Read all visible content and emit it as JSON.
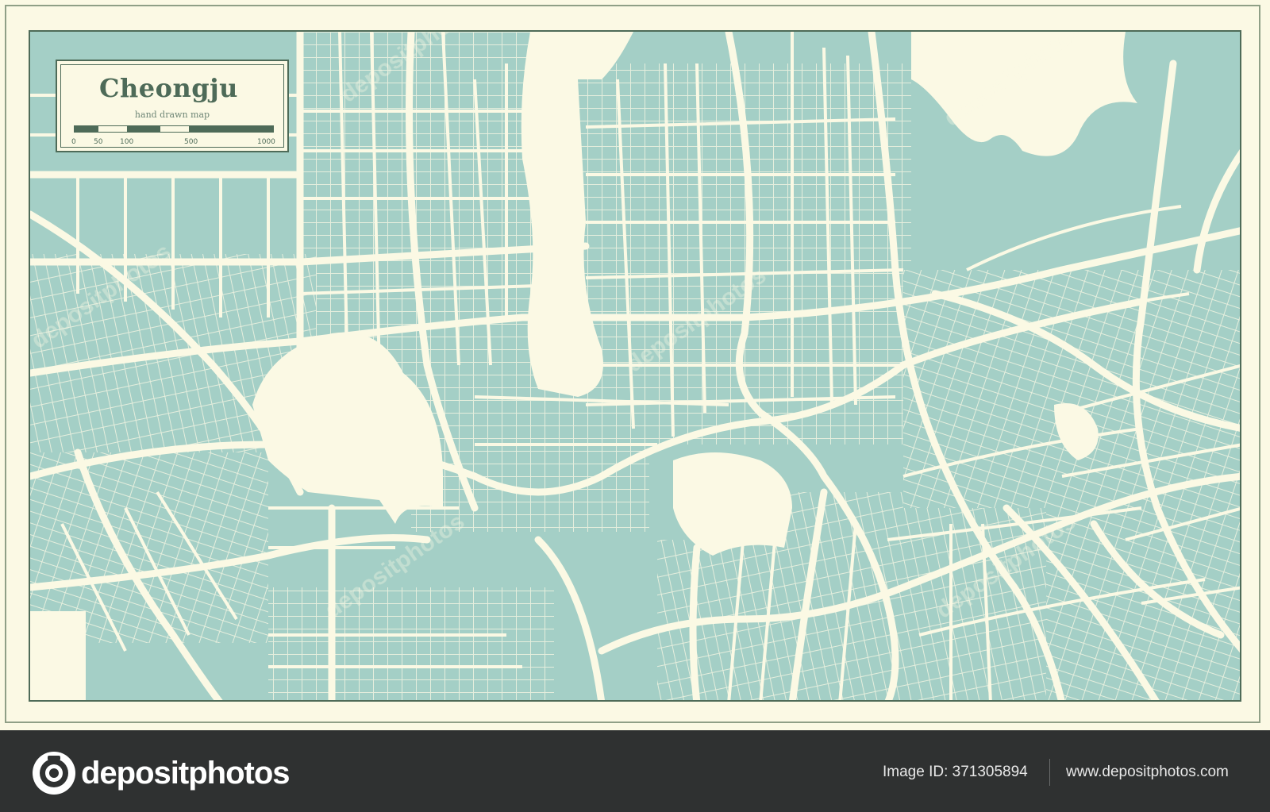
{
  "map": {
    "title": "Cheongju",
    "subtitle": "hand drawn map",
    "scale_labels": [
      "0",
      "50",
      "100",
      "500",
      "1000"
    ],
    "colors": {
      "background": "#fbf9e4",
      "water_block": "#a4cfc6",
      "road": "#fbf9e4",
      "ink": "#4e6b58"
    }
  },
  "footer": {
    "brand": "depositphotos",
    "brand_icon": "camera-icon",
    "image_id": "Image ID: 371305894",
    "url": "www.depositphotos.com"
  }
}
